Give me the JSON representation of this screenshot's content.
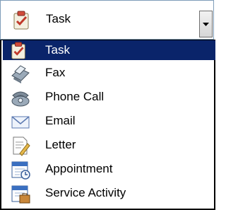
{
  "combo": {
    "selected_label": "Task",
    "icon": "task-icon"
  },
  "dropdown": {
    "items": [
      {
        "label": "Task",
        "icon": "task-icon",
        "selected": true
      },
      {
        "label": "Fax",
        "icon": "fax-icon",
        "selected": false
      },
      {
        "label": "Phone Call",
        "icon": "phone-icon",
        "selected": false
      },
      {
        "label": "Email",
        "icon": "email-icon",
        "selected": false
      },
      {
        "label": "Letter",
        "icon": "letter-icon",
        "selected": false
      },
      {
        "label": "Appointment",
        "icon": "appointment-icon",
        "selected": false
      },
      {
        "label": "Service Activity",
        "icon": "service-activity-icon",
        "selected": false
      }
    ]
  },
  "colors": {
    "selection": "#0a246a",
    "selection_text": "#ffffff"
  }
}
